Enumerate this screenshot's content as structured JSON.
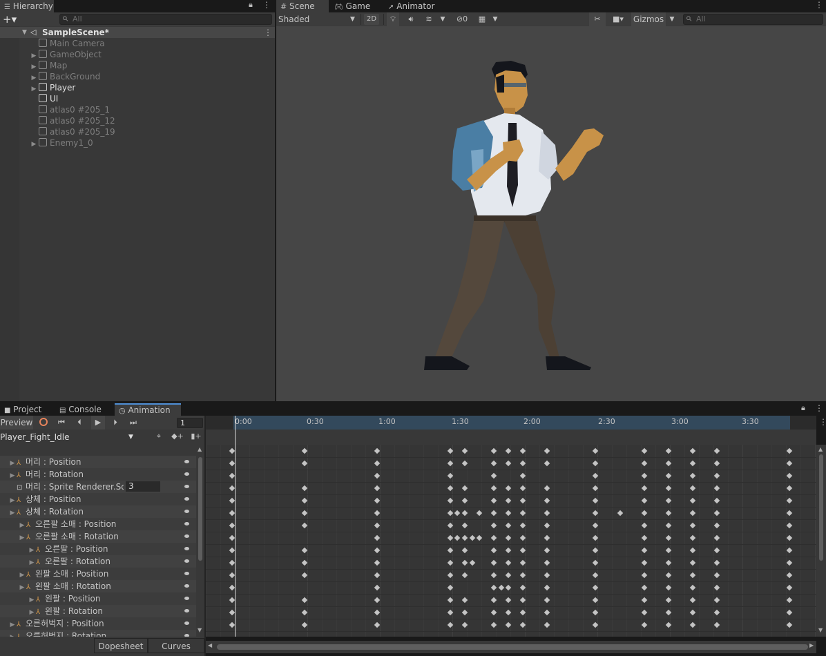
{
  "hierarchy": {
    "tab_label": "Hierarchy",
    "search_placeholder": "All",
    "scene_name": "SampleScene*",
    "items": [
      {
        "label": "Main Camera"
      },
      {
        "label": "GameObject"
      },
      {
        "label": "Map"
      },
      {
        "label": "BackGround"
      },
      {
        "label": "Player"
      },
      {
        "label": "UI"
      },
      {
        "label": "atlas0 #205_1"
      },
      {
        "label": "atlas0 #205_12"
      },
      {
        "label": "atlas0 #205_19"
      },
      {
        "label": "Enemy1_0"
      }
    ]
  },
  "scene_view": {
    "tabs": [
      "Scene",
      "Game",
      "Animator"
    ],
    "shading_mode": "Shaded",
    "mode_2d": "2D",
    "hidden_count": "0",
    "gizmos_label": "Gizmos",
    "search_placeholder": "All"
  },
  "bottom_tabs": [
    "Project",
    "Console",
    "Animation"
  ],
  "animation": {
    "preview_label": "Preview",
    "frame_value": "1",
    "clip_name": "Player_Fight_Idle",
    "timeline_labels": [
      "0:00",
      "0:30",
      "1:00",
      "1:30",
      "2:00",
      "2:30",
      "3:00",
      "3:30"
    ],
    "sprite_value": "3",
    "tracks": [
      {
        "label": "머리 : Position"
      },
      {
        "label": "머리 : Rotation"
      },
      {
        "label": "머리 : Sprite Renderer.Sor"
      },
      {
        "label": "상체 : Position"
      },
      {
        "label": "상체 : Rotation"
      },
      {
        "label": "오른팔 소매 : Position"
      },
      {
        "label": "오른팔 소매 : Rotation"
      },
      {
        "label": "오른팔 : Position"
      },
      {
        "label": "오른팔 : Rotation"
      },
      {
        "label": "왼팔 소매 : Position"
      },
      {
        "label": "왼팔 소매 : Rotation"
      },
      {
        "label": "왼팔 : Position"
      },
      {
        "label": "왼팔 : Rotation"
      },
      {
        "label": "오른허벅지 : Position"
      },
      {
        "label": "오른허벅지 : Rotation"
      }
    ],
    "view_tabs": [
      "Dopesheet",
      "Curves"
    ]
  }
}
